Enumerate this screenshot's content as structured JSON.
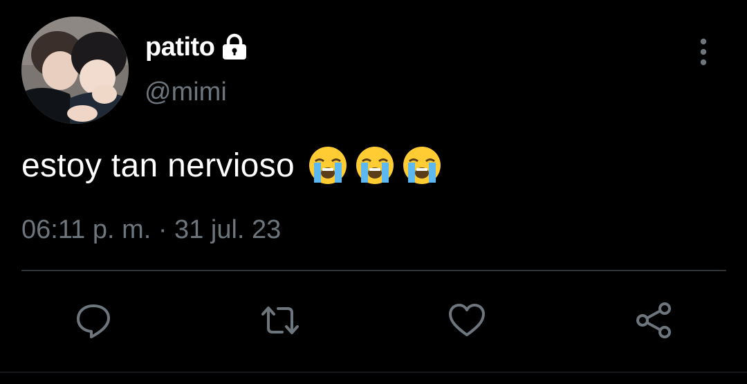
{
  "tweet": {
    "display_name": "patito",
    "handle": "@mimi",
    "protected_icon": "lock-icon",
    "menu_icon": "more-vertical-icon",
    "avatar_alt": "profile-photo",
    "text": "estoy tan nervioso",
    "emojis": [
      "loudly-crying-face",
      "loudly-crying-face",
      "loudly-crying-face"
    ],
    "timestamp": "06:11 p. m. · 31 jul. 23"
  },
  "actions": {
    "reply_icon": "reply-icon",
    "retweet_icon": "retweet-icon",
    "like_icon": "heart-icon",
    "share_icon": "share-icon"
  },
  "colors": {
    "background": "#000000",
    "primary_text": "#ffffff",
    "secondary_text": "#6e767d",
    "divider": "#2f3336",
    "icon": "#6e767d"
  }
}
